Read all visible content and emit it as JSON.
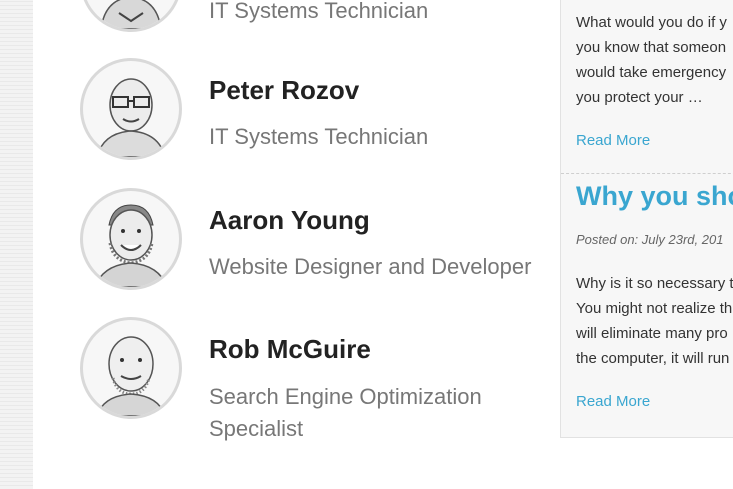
{
  "team": [
    {
      "name": "",
      "role": "IT Systems Technician"
    },
    {
      "name": "Peter Rozov",
      "role": "IT Systems Technician"
    },
    {
      "name": "Aaron Young",
      "role": "Website Designer and Developer"
    },
    {
      "name": "Rob McGuire",
      "role": "Search Engine Optimization Specialist"
    }
  ],
  "sidebar": {
    "post1": {
      "excerpt_lines": [
        "What would you do if y",
        "you know that someon",
        "would take emergency",
        "you protect your …"
      ],
      "read_more": "Read More"
    },
    "post2": {
      "title": "Why you shou",
      "date_line": "Posted on: July 23rd, 201",
      "excerpt_lines": [
        "Why is it so necessary t",
        "You might not realize th",
        "will eliminate many pro",
        "the computer, it will run"
      ],
      "read_more": "Read More"
    }
  },
  "colors": {
    "accent": "#3aa6d0",
    "name": "#222222",
    "role": "#777777"
  }
}
